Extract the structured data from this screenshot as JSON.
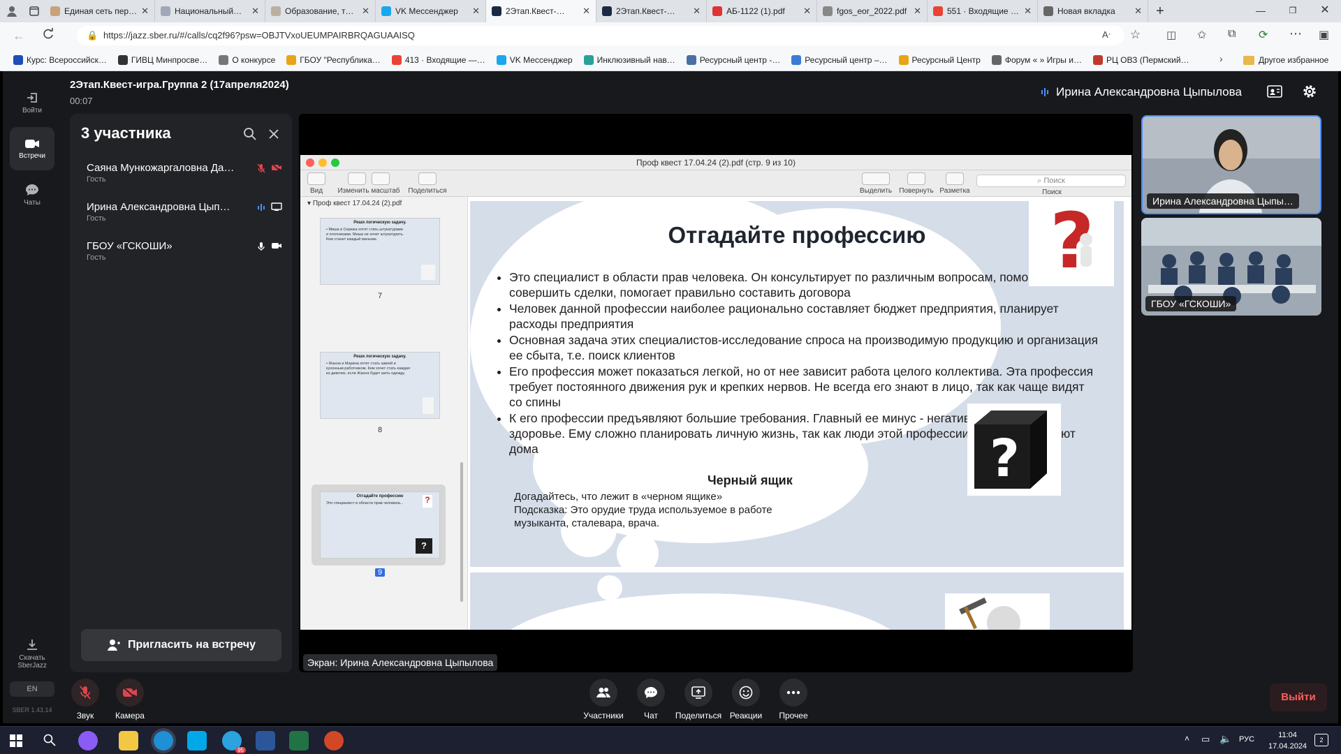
{
  "browser": {
    "tabs": [
      {
        "label": "Единая сеть пере…",
        "color": "#c9a27c"
      },
      {
        "label": "НациональныйЦ…",
        "color": "#a0a8b8"
      },
      {
        "label": "Образование, тр…",
        "color": "#b9b0a0"
      },
      {
        "label": "VK Мессенджер",
        "color": "#1aa7ec"
      },
      {
        "label": "2Этап.Квест-…",
        "color": "#1a2a44",
        "active": true
      },
      {
        "label": "2Этап.Квест-…",
        "color": "#1a2a44"
      },
      {
        "label": "АБ-1122 (1).pdf",
        "color": "#d33"
      },
      {
        "label": "fgos_eor_2022.pdf",
        "color": "#888"
      },
      {
        "label": "551 · Входящие –…",
        "color": "#ea4335"
      },
      {
        "label": "Новая вкладка",
        "color": "#666"
      }
    ],
    "url": "https://jazz.sber.ru/#/calls/cq2f96?psw=OBJTVxoUEUMPAIRBRQAGUAAISQ",
    "bookmarks": [
      {
        "label": "Курс: Всероссийск…",
        "color": "#1e4db7"
      },
      {
        "label": "ГИВЦ Минпросве…",
        "color": "#333"
      },
      {
        "label": "О конкурсе",
        "color": "#777"
      },
      {
        "label": "ГБОУ \"Республика…",
        "color": "#e8a317"
      },
      {
        "label": "413 · Входящие —…",
        "color": "#ea4335"
      },
      {
        "label": "VK Мессенджер",
        "color": "#1aa7ec"
      },
      {
        "label": "Инклюзивный нав…",
        "color": "#2aa198"
      },
      {
        "label": "Ресурсный центр -…",
        "color": "#4a6fa5"
      },
      {
        "label": "Ресурсный центр –…",
        "color": "#3a7bd5"
      },
      {
        "label": "Ресурсный Центр",
        "color": "#e8a317"
      },
      {
        "label": "Форум « » Игры и…",
        "color": "#666"
      },
      {
        "label": "РЦ ОВЗ (Пермский…",
        "color": "#c0392b"
      }
    ],
    "other_bookmarks": "Другое избранное"
  },
  "rail": {
    "login": "Войти",
    "meetings": "Встречи",
    "chats": "Чаты",
    "download": "Скачать SberJazz",
    "lang": "EN",
    "version": "SBER 1.43.14"
  },
  "meeting": {
    "title": "2Этап.Квест-игра.Группа 2 (17апреля2024)",
    "timer": "00:07",
    "active_speaker": "Ирина Александровна Цыпылова"
  },
  "participants_panel": {
    "title": "3 участника",
    "list": [
      {
        "name": "Саяна Мункожаргаловна Да…",
        "role": "Гость"
      },
      {
        "name": "Ирина Александровна Цып…",
        "role": "Гость"
      },
      {
        "name": "ГБОУ «ГСКОШИ»",
        "role": "Гость"
      }
    ],
    "invite_label": "Пригласить на встречу"
  },
  "shared_screen": {
    "window_title": "Проф квест 17.04.24 (2).pdf (стр. 9 из 10)",
    "toolbar": {
      "view": "Вид",
      "zoom": "Изменить масштаб",
      "share": "Поделиться",
      "highlight": "Выделить",
      "rotate": "Повернуть",
      "markup": "Разметка",
      "search_placeholder": "Поиск",
      "search_label": "Поиск"
    },
    "sidebar_file": "Проф квест 17.04.24 (2).pdf",
    "thumbnails": [
      {
        "page": "7",
        "title": "Реши логическую задачу.",
        "text": "• Миша и Сережа хотят стать штукатурами и плотниками. Миша не хочет штукатурить. Кем станет каждый мальчик."
      },
      {
        "page": "8",
        "title": "Реши логическую задачу.",
        "text": "• Жанна и Марина хотят стать швеей и кухонным работником. Кем хочет стать каждая из девочек, если Жанна будет шить одежду."
      },
      {
        "page": "9",
        "title": "Отгадайте профессию",
        "text": "Это специалист в области прав человека..."
      }
    ],
    "slide": {
      "title": "Отгадайте профессию",
      "bullets": [
        "Это специалист в области прав человека. Он консультирует по различным вопросам, помогает совершить сделки, помогает правильно составить договора",
        "Человек данной профессии наиболее рационально составляет бюджет предприятия, планирует расходы предприятия",
        "Основная задача этих специалистов-исследование спроса на производимую продукцию и организация ее сбыта, т.е. поиск клиентов",
        "Его профессия может показаться легкой, но от нее зависит работа целого коллектива. Эта профессия требует постоянного движения рук и крепких нервов. Не всегда его знают в лицо, так как чаще видят со спины",
        "К его профессии предъявляют большие требования. Главный ее минус - негативное влияние на здоровье. Ему сложно планировать личную жизнь, так как люди этой профессии часто отсутствуют дома"
      ],
      "black_box_title": "Черный ящик",
      "black_box_line1": "Догадайтесь, что лежит в «черном ящике»",
      "black_box_line2": "Подсказка: Это орудие труда используемое в работе музыканта, сталевара, врача."
    },
    "label": "Экран: Ирина Александровна Цыпылова"
  },
  "videos": [
    {
      "label": "Ирина Александровна Цыпы…"
    },
    {
      "label": "ГБОУ «ГСКОШИ»"
    }
  ],
  "controls": {
    "sound": "Звук",
    "camera": "Камера",
    "participants": "Участники",
    "chat": "Чат",
    "share": "Поделиться",
    "reactions": "Реакции",
    "more": "Прочее",
    "leave": "Выйти"
  },
  "taskbar": {
    "time": "11:04",
    "date": "17.04.2024",
    "lang": "РУС",
    "notifications": "2",
    "telegram_badge": "95"
  },
  "colors": {
    "app_bg": "#18191c",
    "panel_bg": "#222326",
    "mute_red": "#e0454f",
    "leave_red": "#ff5d5d",
    "speaker_blue": "#4c8dff"
  }
}
